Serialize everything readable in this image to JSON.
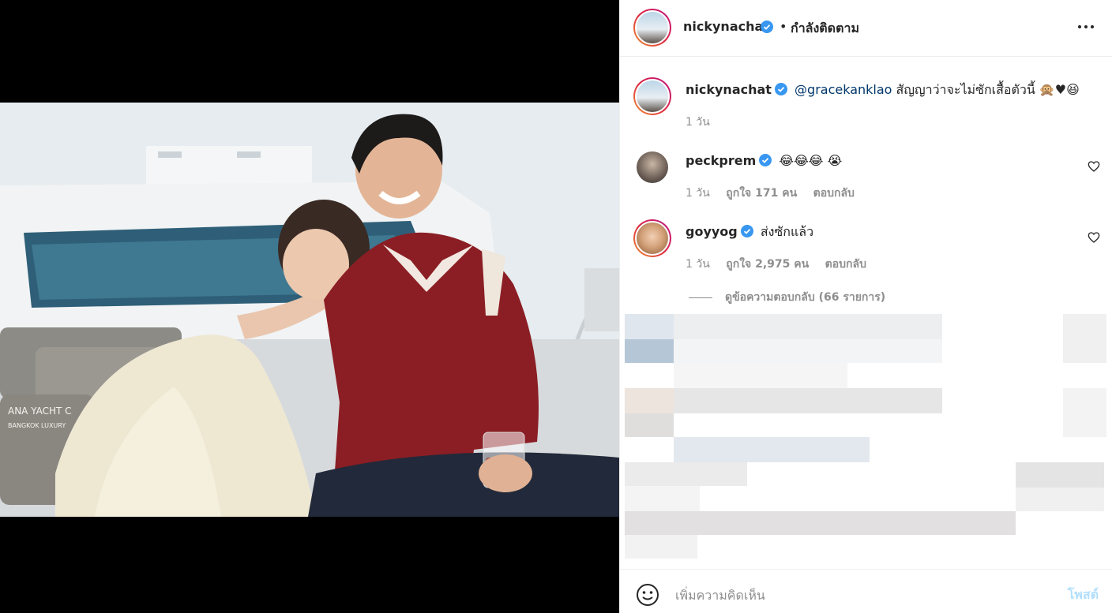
{
  "post": {
    "author": "nickynachat",
    "follow_separator": "•",
    "follow_status": "กำลังติดตาม",
    "more_icon": "more-horizontal-icon"
  },
  "caption": {
    "author": "nickynachat",
    "mention": "@gracekanklao",
    "text": "สัญญาว่าจะไม่ซักเสื้อตัวนี้ 🙊♥😆",
    "time": "1 วัน"
  },
  "comments": [
    {
      "author": "peckprem",
      "text": "😂😂😂 😭",
      "time": "1 วัน",
      "likes": "ถูกใจ 171 คน",
      "reply": "ตอบกลับ"
    },
    {
      "author": "goyyog",
      "text": "ส่งซักแล้ว",
      "time": "1 วัน",
      "likes": "ถูกใจ 2,975 คน",
      "reply": "ตอบกลับ"
    }
  ],
  "view_replies": "ดูข้อความตอบกลับ (66 รายการ)",
  "composer": {
    "placeholder": "เพิ่มความคิดเห็น",
    "post_label": "โพสต์",
    "emoji_icon": "emoji-smile-icon"
  },
  "colors": {
    "verified": "#3897f0",
    "link": "#00376b",
    "post_disabled": "#b2dffc",
    "jacket": "#8b1e24",
    "dress": "#efe9d6"
  }
}
